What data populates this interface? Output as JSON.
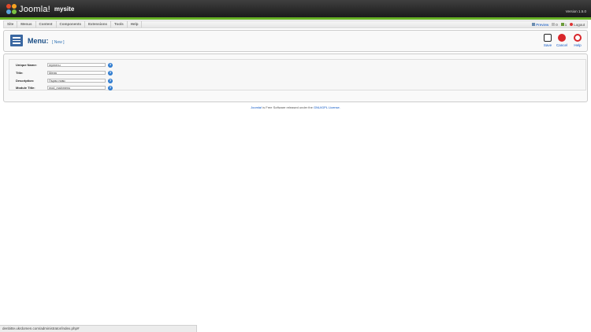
{
  "header": {
    "brand": "Joomla!",
    "site_name": "mysite",
    "version": "Version 1.5.0"
  },
  "menubar": {
    "items": [
      "Site",
      "Menus",
      "Content",
      "Components",
      "Extensions",
      "Tools",
      "Help"
    ],
    "preview_label": "Preview",
    "messages_count": "0",
    "users_count": "1",
    "logout_label": "Logout"
  },
  "toolbar": {
    "title": "Menu:",
    "subtitle": "[ New ]",
    "save_label": "Save",
    "cancel_label": "Cancel",
    "help_label": "Help"
  },
  "form": {
    "unique_name": {
      "label": "Unique Name:",
      "value": "mymenu"
    },
    "title": {
      "label": "Title:",
      "value": "Меню"
    },
    "description": {
      "label": "Description:",
      "value": "Първо ниво"
    },
    "module_title": {
      "label": "Module Title:",
      "value": "mod_mainmenu"
    }
  },
  "footer": {
    "link1": "Joomla!",
    "text": "is Free Software released under the",
    "link2": "GNU/GPL License."
  },
  "status_bar": "denbitte.ukrdomen.com/administrator/index.php#"
}
